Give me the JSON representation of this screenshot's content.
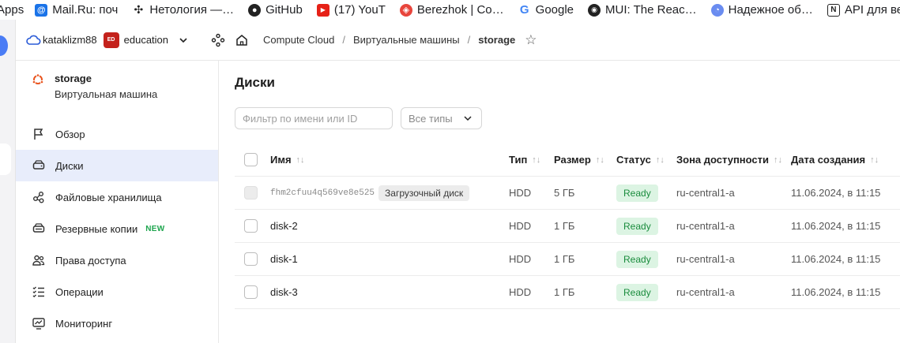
{
  "bookmarks": [
    {
      "label": "Apps",
      "icon": "apps-icon"
    },
    {
      "label": "Mail.Ru: поч",
      "icon": "mailru-icon"
    },
    {
      "label": "Нетология —…",
      "icon": "netology-icon"
    },
    {
      "label": "GitHub",
      "icon": "github-icon"
    },
    {
      "label": "(17) YouT",
      "icon": "youtube-icon"
    },
    {
      "label": "Berezhok | Co…",
      "icon": "berezhok-icon"
    },
    {
      "label": "Google",
      "icon": "google-icon"
    },
    {
      "label": "MUI: The Reac…",
      "icon": "mui-icon"
    },
    {
      "label": "Надежное об…",
      "icon": "bookmark-icon"
    },
    {
      "label": "API для веб",
      "icon": "notion-icon"
    }
  ],
  "header": {
    "cloud": "kataklizm88",
    "folder_badge": "ED",
    "folder": "education",
    "crumbs": [
      "Compute Cloud",
      "Виртуальные машины",
      "storage"
    ]
  },
  "sidebar": {
    "vm_name": "storage",
    "vm_subtitle": "Виртуальная машина",
    "items": [
      {
        "label": "Обзор",
        "icon": "flag-icon"
      },
      {
        "label": "Диски",
        "icon": "disk-icon"
      },
      {
        "label": "Файловые хранилища",
        "icon": "file-storage-icon"
      },
      {
        "label": "Резервные копии",
        "icon": "backup-icon",
        "badge": "NEW"
      },
      {
        "label": "Права доступа",
        "icon": "users-icon"
      },
      {
        "label": "Операции",
        "icon": "operations-icon"
      },
      {
        "label": "Мониторинг",
        "icon": "monitoring-icon"
      }
    ]
  },
  "main": {
    "title": "Диски",
    "filter_placeholder": "Фильтр по имени или ID",
    "type_select": "Все типы",
    "columns": [
      "Имя",
      "Тип",
      "Размер",
      "Статус",
      "Зона доступности",
      "Дата создания"
    ],
    "rows": [
      {
        "name": "fhm2cfuu4q569ve8e525",
        "tag": "Загрузочный диск",
        "type": "HDD",
        "size": "5 ГБ",
        "status": "Ready",
        "zone": "ru-central1-a",
        "created": "11.06.2024, в 11:15"
      },
      {
        "name": "disk-2",
        "tag": "",
        "type": "HDD",
        "size": "1 ГБ",
        "status": "Ready",
        "zone": "ru-central1-a",
        "created": "11.06.2024, в 11:15"
      },
      {
        "name": "disk-1",
        "tag": "",
        "type": "HDD",
        "size": "1 ГБ",
        "status": "Ready",
        "zone": "ru-central1-a",
        "created": "11.06.2024, в 11:15"
      },
      {
        "name": "disk-3",
        "tag": "",
        "type": "HDD",
        "size": "1 ГБ",
        "status": "Ready",
        "zone": "ru-central1-a",
        "created": "11.06.2024, в 11:15"
      }
    ]
  },
  "colors": {
    "accent": "#4a7cf5",
    "active_bg": "#e8edfb",
    "ready_bg": "#dcf4e3",
    "ready_text": "#1a8c3d",
    "new_badge": "#1ea54e",
    "folder_badge": "#c4221c"
  }
}
